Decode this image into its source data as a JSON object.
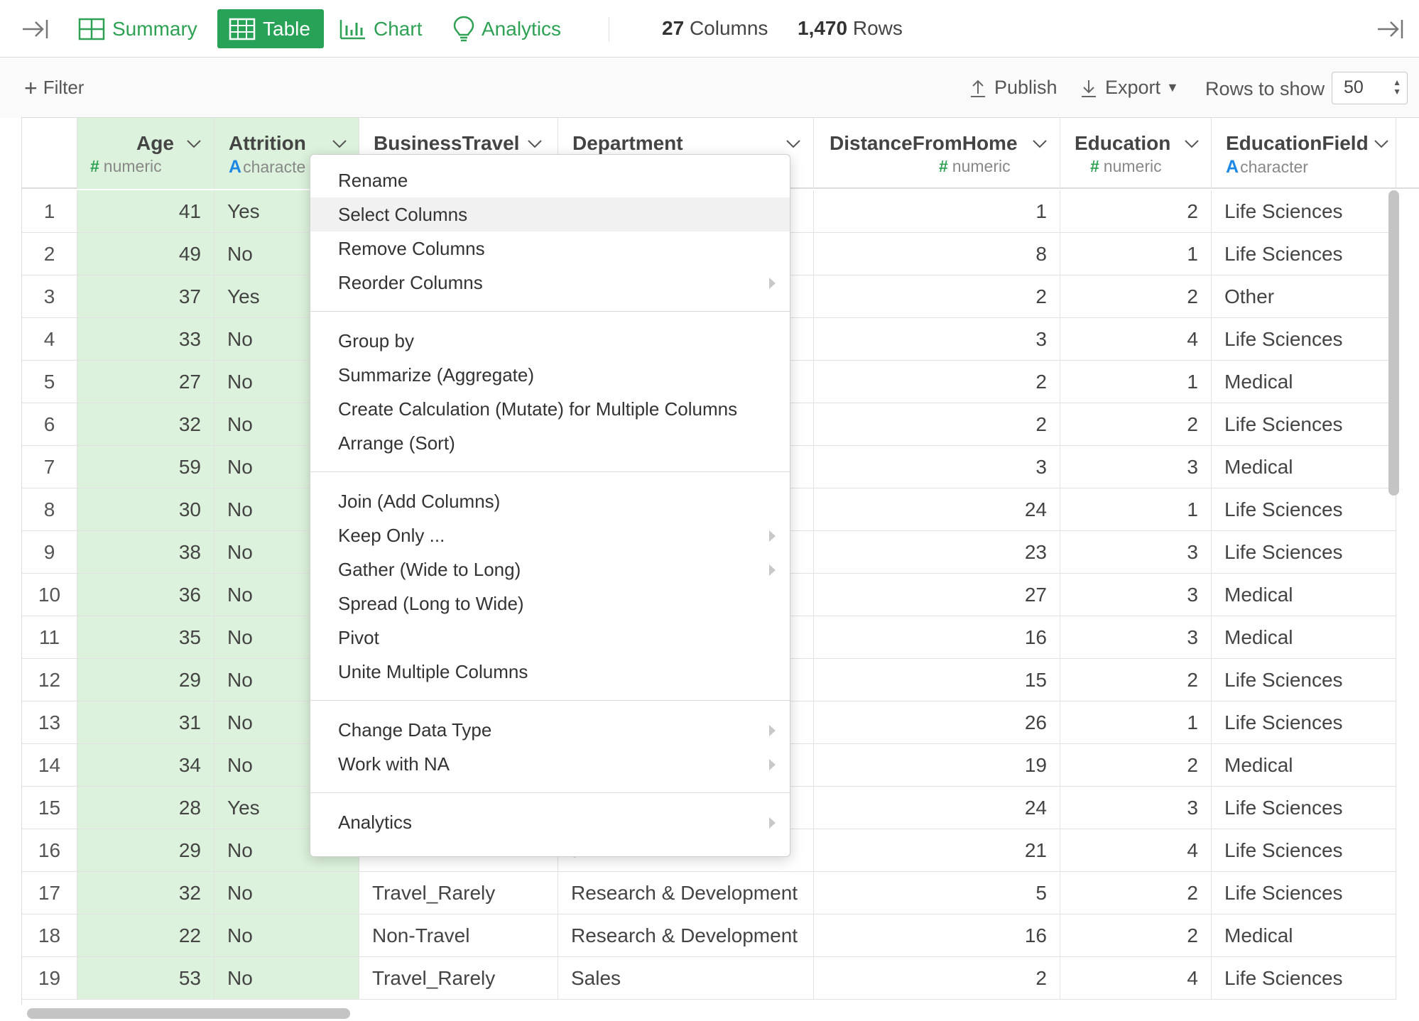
{
  "toolbar": {
    "tabs": [
      {
        "label": "Summary",
        "icon": "grid-icon"
      },
      {
        "label": "Table",
        "icon": "table-icon",
        "active": true
      },
      {
        "label": "Chart",
        "icon": "bar-chart-icon"
      },
      {
        "label": "Analytics",
        "icon": "lightbulb-icon"
      }
    ],
    "columns_count": "27",
    "columns_label": "Columns",
    "rows_count": "1,470",
    "rows_label": "Rows",
    "accent_color": "#27a256"
  },
  "filterbar": {
    "filter_label": "Filter",
    "publish_label": "Publish",
    "export_label": "Export",
    "rows_to_show_label": "Rows to show",
    "rows_to_show_value": "50"
  },
  "table": {
    "columns": [
      {
        "name": "Age",
        "type": "numeric"
      },
      {
        "name": "Attrition",
        "type": "character"
      },
      {
        "name": "BusinessTravel",
        "type": "character"
      },
      {
        "name": "Department",
        "type": "character"
      },
      {
        "name": "DistanceFromHome",
        "type": "numeric"
      },
      {
        "name": "Education",
        "type": "numeric"
      },
      {
        "name": "EducationField",
        "type": "character"
      }
    ],
    "attrition_type_visible": "characte",
    "selected_column": "Age",
    "rows": [
      {
        "n": "1",
        "age": "41",
        "attr": "Yes",
        "travel": "",
        "dept": "",
        "dist": "1",
        "edu": "2",
        "field": "Life Sciences"
      },
      {
        "n": "2",
        "age": "49",
        "attr": "No",
        "travel": "",
        "dept": "t",
        "dist": "8",
        "edu": "1",
        "field": "Life Sciences"
      },
      {
        "n": "3",
        "age": "37",
        "attr": "Yes",
        "travel": "",
        "dept": "t",
        "dist": "2",
        "edu": "2",
        "field": "Other"
      },
      {
        "n": "4",
        "age": "33",
        "attr": "No",
        "travel": "",
        "dept": "t",
        "dist": "3",
        "edu": "4",
        "field": "Life Sciences"
      },
      {
        "n": "5",
        "age": "27",
        "attr": "No",
        "travel": "",
        "dept": "t",
        "dist": "2",
        "edu": "1",
        "field": "Medical"
      },
      {
        "n": "6",
        "age": "32",
        "attr": "No",
        "travel": "",
        "dept": "t",
        "dist": "2",
        "edu": "2",
        "field": "Life Sciences"
      },
      {
        "n": "7",
        "age": "59",
        "attr": "No",
        "travel": "",
        "dept": "t",
        "dist": "3",
        "edu": "3",
        "field": "Medical"
      },
      {
        "n": "8",
        "age": "30",
        "attr": "No",
        "travel": "",
        "dept": "t",
        "dist": "24",
        "edu": "1",
        "field": "Life Sciences"
      },
      {
        "n": "9",
        "age": "38",
        "attr": "No",
        "travel": "",
        "dept": "t",
        "dist": "23",
        "edu": "3",
        "field": "Life Sciences"
      },
      {
        "n": "10",
        "age": "36",
        "attr": "No",
        "travel": "",
        "dept": "t",
        "dist": "27",
        "edu": "3",
        "field": "Medical"
      },
      {
        "n": "11",
        "age": "35",
        "attr": "No",
        "travel": "",
        "dept": "t",
        "dist": "16",
        "edu": "3",
        "field": "Medical"
      },
      {
        "n": "12",
        "age": "29",
        "attr": "No",
        "travel": "",
        "dept": "t",
        "dist": "15",
        "edu": "2",
        "field": "Life Sciences"
      },
      {
        "n": "13",
        "age": "31",
        "attr": "No",
        "travel": "",
        "dept": "t",
        "dist": "26",
        "edu": "1",
        "field": "Life Sciences"
      },
      {
        "n": "14",
        "age": "34",
        "attr": "No",
        "travel": "",
        "dept": "t",
        "dist": "19",
        "edu": "2",
        "field": "Medical"
      },
      {
        "n": "15",
        "age": "28",
        "attr": "Yes",
        "travel": "",
        "dept": "t",
        "dist": "24",
        "edu": "3",
        "field": "Life Sciences"
      },
      {
        "n": "16",
        "age": "29",
        "attr": "No",
        "travel": "",
        "dept": "t",
        "dist": "21",
        "edu": "4",
        "field": "Life Sciences"
      },
      {
        "n": "17",
        "age": "32",
        "attr": "No",
        "travel": "Travel_Rarely",
        "dept": "Research & Development",
        "dist": "5",
        "edu": "2",
        "field": "Life Sciences"
      },
      {
        "n": "18",
        "age": "22",
        "attr": "No",
        "travel": "Non-Travel",
        "dept": "Research & Development",
        "dist": "16",
        "edu": "2",
        "field": "Medical"
      },
      {
        "n": "19",
        "age": "53",
        "attr": "No",
        "travel": "Travel_Rarely",
        "dept": "Sales",
        "dist": "2",
        "edu": "4",
        "field": "Life Sciences"
      }
    ]
  },
  "context_menu": {
    "groups": [
      [
        {
          "label": "Rename",
          "submenu": false
        },
        {
          "label": "Select Columns",
          "submenu": false,
          "highlighted": true
        },
        {
          "label": "Remove Columns",
          "submenu": false
        },
        {
          "label": "Reorder Columns",
          "submenu": true
        }
      ],
      [
        {
          "label": "Group by",
          "submenu": false
        },
        {
          "label": "Summarize (Aggregate)",
          "submenu": false
        },
        {
          "label": "Create Calculation (Mutate) for Multiple Columns",
          "submenu": false
        },
        {
          "label": "Arrange (Sort)",
          "submenu": false
        }
      ],
      [
        {
          "label": "Join (Add Columns)",
          "submenu": false
        },
        {
          "label": "Keep Only ...",
          "submenu": true
        },
        {
          "label": "Gather (Wide to Long)",
          "submenu": true
        },
        {
          "label": "Spread (Long to Wide)",
          "submenu": false
        },
        {
          "label": "Pivot",
          "submenu": false
        },
        {
          "label": "Unite Multiple Columns",
          "submenu": false
        }
      ],
      [
        {
          "label": "Change Data Type",
          "submenu": true
        },
        {
          "label": "Work with NA",
          "submenu": true
        }
      ],
      [
        {
          "label": "Analytics",
          "submenu": true
        }
      ]
    ]
  }
}
